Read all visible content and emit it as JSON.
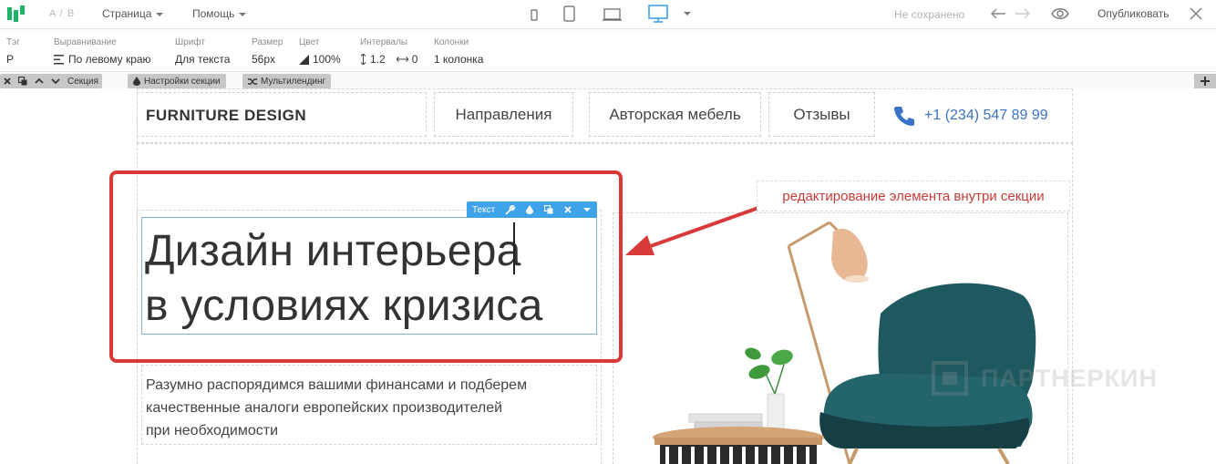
{
  "topbar": {
    "ab_label": "A / B",
    "menu_page": "Страница",
    "menu_help": "Помощь",
    "status": "Не сохранено",
    "publish_label": "Опубликовать"
  },
  "props": {
    "tag_label": "Тэг",
    "tag_value": "P",
    "align_label": "Выравнивание",
    "align_value": "По левому краю",
    "font_label": "Шрифт",
    "font_value": "Для текста",
    "size_label": "Размер",
    "size_value": "56px",
    "color_label": "Цвет",
    "color_value": "100%",
    "intervals_label": "Интервалы",
    "line_value": "1.2",
    "letter_value": "0",
    "columns_label": "Колонки",
    "columns_value": "1 колонка"
  },
  "section_bar": {
    "section_label": "Секция",
    "settings_label": "Настройки секции",
    "multilanding_label": "Мультилендинг"
  },
  "site": {
    "brand": "FURNITURE DESIGN",
    "nav": [
      "Направления",
      "Авторская мебель",
      "Отзывы"
    ],
    "phone": "+1 (234) 547 89 99",
    "title_line1": "Дизайн интерьера",
    "title_line2": "в условиях кризиса",
    "para_line1": "Разумно распорядимся вашими финансами и подберем",
    "para_line2": "качественные аналоги европейских производителей",
    "para_line3": "при необходимости"
  },
  "editor": {
    "element_label": "Текст",
    "annotation": "редактирование элемента внутри секции"
  },
  "watermark": "ПАРТНЕРКИН",
  "colors": {
    "accent_blue": "#3fa3ea",
    "phone_blue": "#3a72c4",
    "annotation_red": "#d83a3a",
    "logo_green": "#1fb36a"
  }
}
